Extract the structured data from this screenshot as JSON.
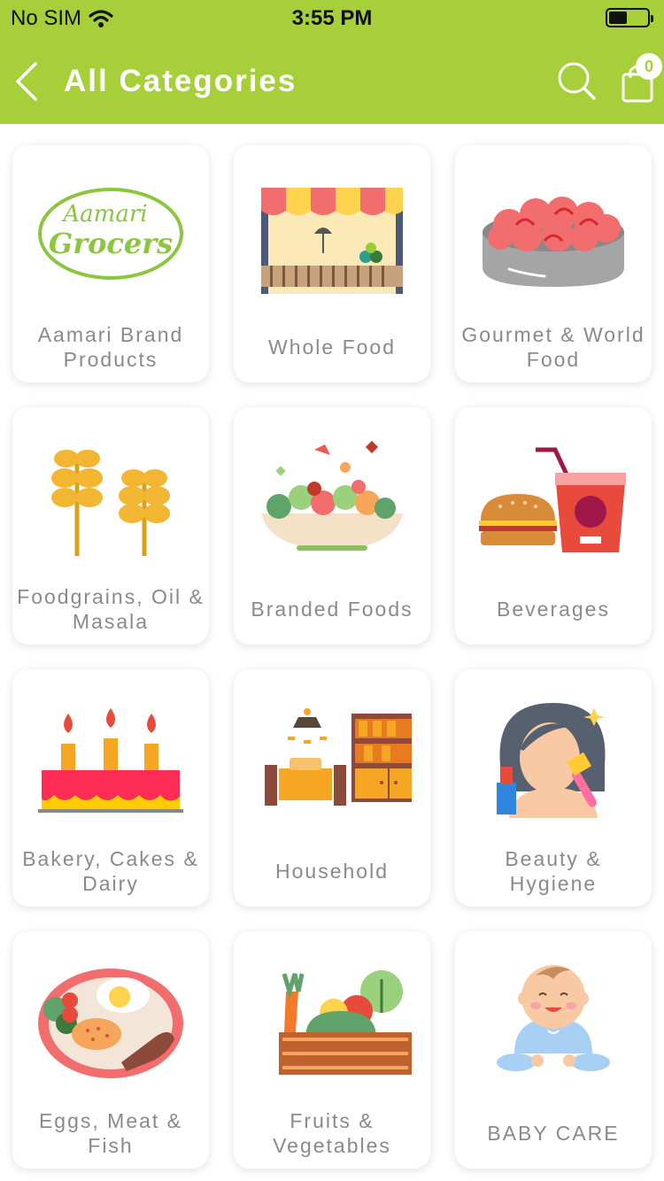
{
  "status_bar": {
    "carrier": "No SIM",
    "time": "3:55 PM"
  },
  "header": {
    "title": "All Categories",
    "cart_count": "0"
  },
  "brand_logo": {
    "line1": "Aamari",
    "line2": "Grocers"
  },
  "categories": [
    {
      "label": "Aamari Brand Products",
      "icon": "aamari-grocers-logo"
    },
    {
      "label": "Whole Food",
      "icon": "market-stall-icon"
    },
    {
      "label": "Gourmet & World Food",
      "icon": "gourmet-bowl-icon"
    },
    {
      "label": "Foodgrains, Oil & Masala",
      "icon": "wheat-icon"
    },
    {
      "label": "Branded Foods",
      "icon": "salad-bowl-icon"
    },
    {
      "label": "Beverages",
      "icon": "burger-drink-icon"
    },
    {
      "label": "Bakery, Cakes & Dairy",
      "icon": "birthday-cake-icon"
    },
    {
      "label": "Household",
      "icon": "household-furniture-icon"
    },
    {
      "label": "Beauty & Hygiene",
      "icon": "beauty-woman-icon"
    },
    {
      "label": "Eggs, Meat & Fish",
      "icon": "egg-meat-plate-icon"
    },
    {
      "label": "Fruits & Vegetables",
      "icon": "vegetable-crate-icon"
    },
    {
      "label": "BABY CARE",
      "icon": "baby-icon"
    }
  ],
  "colors": {
    "accent": "#a6cf3a",
    "label": "#8a8a8a"
  }
}
